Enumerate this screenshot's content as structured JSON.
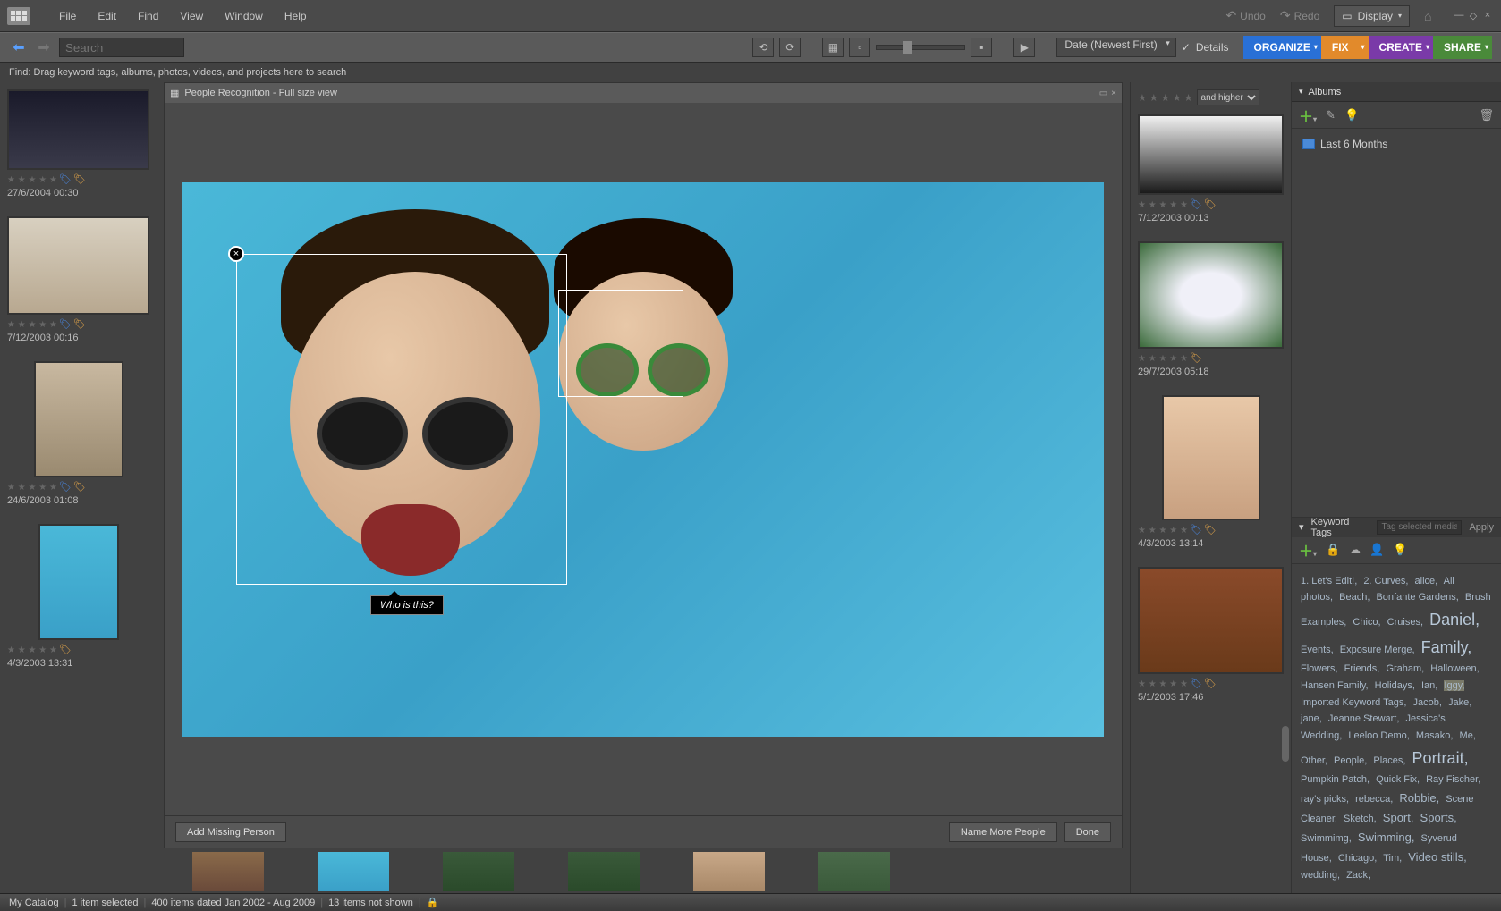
{
  "menu": {
    "file": "File",
    "edit": "Edit",
    "find": "Find",
    "view": "View",
    "window": "Window",
    "help": "Help"
  },
  "toolbar": {
    "undo": "Undo",
    "redo": "Redo",
    "display": "Display"
  },
  "search": {
    "placeholder": "Search"
  },
  "sort": {
    "value": "Date (Newest First)"
  },
  "details": {
    "label": "Details"
  },
  "modes": {
    "organize": "ORGANIZE",
    "fix": "FIX",
    "create": "CREATE",
    "share": "SHARE"
  },
  "find_hint": "Find: Drag keyword tags, albums, photos, videos, and projects here to search",
  "rating_filter": {
    "label": "and higher"
  },
  "left_thumbs": [
    {
      "date": "27/6/2004 00:30"
    },
    {
      "date": "7/12/2003 00:16"
    },
    {
      "date": "24/6/2003 01:08"
    },
    {
      "date": "4/3/2003 13:31"
    }
  ],
  "right_thumbs": [
    {
      "date": "7/12/2003 00:13"
    },
    {
      "date": "29/7/2003 05:18"
    },
    {
      "date": "4/3/2003 13:14"
    },
    {
      "date": "5/1/2003 17:46"
    }
  ],
  "viewer": {
    "title": "People Recognition - Full size view",
    "who_is_this": "Who is this?",
    "add_missing": "Add Missing Person",
    "name_more": "Name More People",
    "done": "Done"
  },
  "albums_panel": {
    "title": "Albums",
    "items": [
      {
        "label": "Last 6 Months"
      }
    ]
  },
  "tags_panel": {
    "title": "Keyword Tags",
    "placeholder": "Tag selected media",
    "apply": "Apply",
    "tags": [
      {
        "t": "1. Let's Edit!",
        "s": ""
      },
      {
        "t": "2. Curves",
        "s": ""
      },
      {
        "t": "alice",
        "s": ""
      },
      {
        "t": "All photos",
        "s": ""
      },
      {
        "t": "Beach",
        "s": ""
      },
      {
        "t": "Bonfante Gardens",
        "s": ""
      },
      {
        "t": "Brush Examples",
        "s": ""
      },
      {
        "t": "Chico",
        "s": ""
      },
      {
        "t": "Cruises",
        "s": ""
      },
      {
        "t": "Daniel",
        "s": "lg"
      },
      {
        "t": "Events",
        "s": ""
      },
      {
        "t": "Exposure Merge",
        "s": ""
      },
      {
        "t": "Family",
        "s": "lg"
      },
      {
        "t": "Flowers",
        "s": ""
      },
      {
        "t": "Friends",
        "s": ""
      },
      {
        "t": "Graham",
        "s": ""
      },
      {
        "t": "Halloween",
        "s": ""
      },
      {
        "t": "Hansen Family",
        "s": ""
      },
      {
        "t": "Holidays",
        "s": ""
      },
      {
        "t": "Ian",
        "s": ""
      },
      {
        "t": "Iggy",
        "s": "hi"
      },
      {
        "t": "Imported Keyword Tags",
        "s": ""
      },
      {
        "t": "Jacob",
        "s": ""
      },
      {
        "t": "Jake",
        "s": ""
      },
      {
        "t": "jane",
        "s": ""
      },
      {
        "t": "Jeanne Stewart",
        "s": ""
      },
      {
        "t": "Jessica's Wedding",
        "s": ""
      },
      {
        "t": "Leeloo Demo",
        "s": ""
      },
      {
        "t": "Masako",
        "s": ""
      },
      {
        "t": "Me",
        "s": ""
      },
      {
        "t": "Other",
        "s": ""
      },
      {
        "t": "People",
        "s": ""
      },
      {
        "t": "Places",
        "s": ""
      },
      {
        "t": "Portrait",
        "s": "lg"
      },
      {
        "t": "Pumpkin Patch",
        "s": ""
      },
      {
        "t": "Quick Fix",
        "s": ""
      },
      {
        "t": "Ray Fischer",
        "s": ""
      },
      {
        "t": "ray's picks",
        "s": ""
      },
      {
        "t": "rebecca",
        "s": ""
      },
      {
        "t": "Robbie",
        "s": "md"
      },
      {
        "t": "Scene Cleaner",
        "s": ""
      },
      {
        "t": "Sketch",
        "s": ""
      },
      {
        "t": "Sport",
        "s": "md"
      },
      {
        "t": "Sports",
        "s": "md"
      },
      {
        "t": "Swimmimg",
        "s": ""
      },
      {
        "t": "Swimming",
        "s": "md"
      },
      {
        "t": "Syverud House",
        "s": ""
      },
      {
        "t": "Chicago",
        "s": ""
      },
      {
        "t": "Tim",
        "s": ""
      },
      {
        "t": "Video stills",
        "s": "md"
      },
      {
        "t": "wedding",
        "s": ""
      },
      {
        "t": "Zack",
        "s": ""
      }
    ]
  },
  "status": {
    "catalog": "My Catalog",
    "selected": "1 item selected",
    "dated": "400 items dated Jan 2002 - Aug 2009",
    "not_shown": "13 items not shown"
  }
}
